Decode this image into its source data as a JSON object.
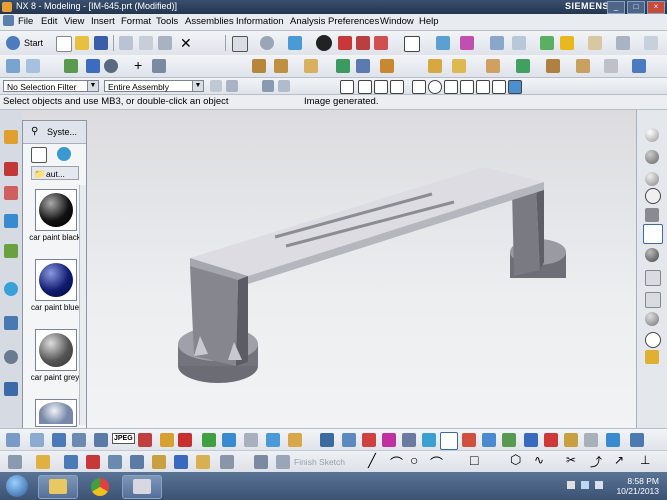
{
  "window": {
    "title": "NX 8 - Modeling - [IM-645.prt (Modified)]",
    "brand": "SIEMENS"
  },
  "menu": [
    "File",
    "Edit",
    "View",
    "Insert",
    "Format",
    "Tools",
    "Assemblies",
    "Information",
    "Analysis",
    "Preferences",
    "Window",
    "Help"
  ],
  "toolbar": {
    "start_label": "Start",
    "sketch_label": "Finish Sketch"
  },
  "selection": {
    "filter": "No Selection Filter",
    "scope": "Entire Assembly"
  },
  "status": {
    "prompt": "Select objects and use MB3, or double-click an object",
    "message": "Image generated."
  },
  "palette": {
    "title": "Syste...",
    "folder": "aut...",
    "materials": [
      {
        "label": "car paint black"
      },
      {
        "label": "car paint blue"
      },
      {
        "label": "car paint grey"
      }
    ]
  },
  "clock": {
    "time": "8:58 PM",
    "date": "10/21/2013"
  },
  "colors": {
    "accent": "#2a4060",
    "viewport": "#e6e7ea",
    "part": "#8a8a92"
  }
}
